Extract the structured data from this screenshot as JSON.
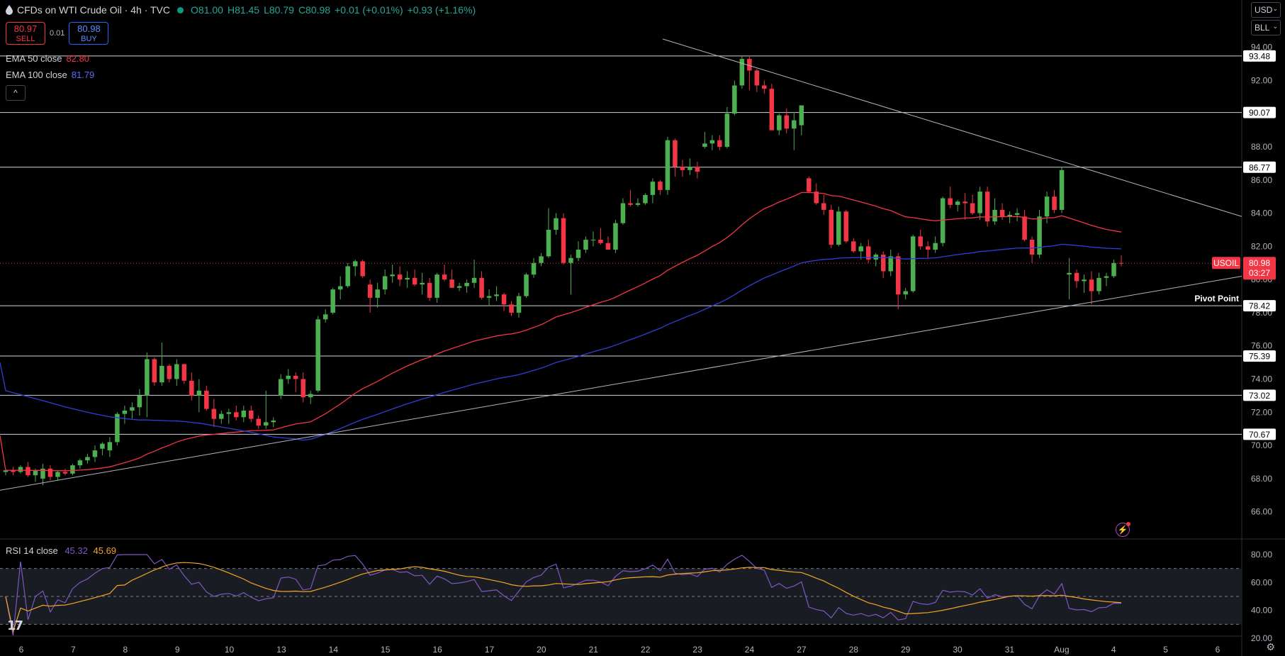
{
  "header": {
    "title": "CFDs on WTI Crude Oil · 4h · TVC",
    "open": "O81.00",
    "high": "H81.45",
    "low": "L80.79",
    "close": "C80.98",
    "change": "+0.01 (+0.01%)",
    "change2": "+0.93 (+1.16%)"
  },
  "trade": {
    "sell_price": "80.97",
    "sell_label": "SELL",
    "spread": "0.01",
    "buy_price": "80.98",
    "buy_label": "BUY"
  },
  "indicators": {
    "ema50_label": "EMA 50 close",
    "ema50_value": "82.80",
    "ema100_label": "EMA 100 close",
    "ema100_value": "81.79",
    "collapse_glyph": "^"
  },
  "currency": {
    "value": "USD",
    "unit": "BLL"
  },
  "rsi": {
    "label": "RSI 14 close",
    "value": "45.32",
    "ma_value": "45.69"
  },
  "logo": "17",
  "colors": {
    "up": "#4caf50",
    "down": "#f23645",
    "ema50": "#f23645",
    "ema100": "#2f3fd6",
    "rsi": "#7e57c2",
    "rsi_ma": "#f5a623"
  },
  "chart_data": {
    "type": "candlestick",
    "symbol_label": "USOIL",
    "last_price": "80.98",
    "countdown": "03:27",
    "y_axis": {
      "min": 65.0,
      "max": 94.5,
      "ticks": [
        "94.00",
        "92.00",
        "90.00",
        "88.00",
        "86.00",
        "84.00",
        "82.00",
        "80.00",
        "78.00",
        "76.00",
        "74.00",
        "72.00",
        "70.00",
        "68.00",
        "66.00"
      ]
    },
    "x_ticks": [
      "6",
      "7",
      "8",
      "9",
      "10",
      "13",
      "14",
      "15",
      "16",
      "17",
      "20",
      "21",
      "22",
      "23",
      "24",
      "27",
      "28",
      "29",
      "30",
      "31",
      "Aug",
      "4",
      "5",
      "6"
    ],
    "levels": [
      93.48,
      90.07,
      86.77,
      78.42,
      75.39,
      73.02,
      70.67
    ],
    "level_labels": [
      "93.48",
      "90.07",
      "86.77",
      "78.42",
      "75.39",
      "73.02",
      "70.67"
    ],
    "pivot_label": "Pivot Point",
    "candles": [
      [
        68.4,
        68.6,
        68.2,
        68.5
      ],
      [
        68.5,
        68.7,
        68.2,
        68.4
      ],
      [
        68.4,
        68.8,
        68.3,
        68.7
      ],
      [
        68.7,
        69.0,
        68.1,
        68.2
      ],
      [
        68.2,
        68.6,
        67.8,
        68.5
      ],
      [
        68.0,
        68.9,
        67.6,
        68.6
      ],
      [
        68.6,
        68.8,
        67.9,
        68.1
      ],
      [
        68.1,
        68.5,
        67.9,
        68.4
      ],
      [
        68.4,
        68.6,
        68.2,
        68.3
      ],
      [
        68.3,
        68.9,
        68.2,
        68.8
      ],
      [
        68.8,
        69.2,
        68.6,
        69.1
      ],
      [
        69.1,
        69.5,
        68.9,
        69.3
      ],
      [
        69.3,
        70.0,
        69.0,
        69.7
      ],
      [
        69.8,
        70.2,
        69.4,
        70.1
      ],
      [
        69.7,
        70.5,
        69.3,
        70.2
      ],
      [
        70.2,
        72.0,
        70.0,
        71.9
      ],
      [
        71.9,
        72.4,
        71.3,
        72.1
      ],
      [
        72.1,
        72.6,
        71.6,
        72.3
      ],
      [
        72.3,
        73.4,
        71.8,
        73.0
      ],
      [
        73.0,
        75.6,
        71.7,
        75.2
      ],
      [
        75.2,
        75.3,
        73.6,
        73.8
      ],
      [
        73.8,
        76.2,
        73.6,
        74.8
      ],
      [
        74.8,
        74.9,
        73.8,
        74.0
      ],
      [
        74.0,
        75.2,
        73.6,
        74.9
      ],
      [
        74.9,
        74.9,
        73.7,
        73.9
      ],
      [
        73.9,
        74.4,
        72.7,
        73.0
      ],
      [
        73.0,
        74.0,
        72.0,
        73.3
      ],
      [
        73.3,
        73.6,
        72.1,
        72.2
      ],
      [
        72.2,
        72.8,
        71.1,
        71.6
      ],
      [
        71.6,
        72.1,
        71.3,
        71.9
      ],
      [
        71.9,
        72.2,
        71.3,
        72.0
      ],
      [
        72.0,
        72.4,
        71.5,
        71.7
      ],
      [
        71.7,
        72.4,
        71.4,
        72.1
      ],
      [
        72.1,
        72.4,
        71.4,
        71.6
      ],
      [
        71.6,
        71.8,
        71.0,
        71.2
      ],
      [
        71.2,
        73.3,
        71.0,
        71.4
      ],
      [
        71.4,
        71.7,
        71.1,
        71.5
      ],
      [
        73.0,
        74.3,
        72.8,
        74.0
      ],
      [
        74.0,
        74.6,
        73.7,
        74.2
      ],
      [
        74.2,
        74.4,
        73.2,
        74.0
      ],
      [
        74.0,
        74.4,
        72.6,
        72.9
      ],
      [
        72.9,
        73.3,
        72.5,
        73.1
      ],
      [
        73.3,
        77.8,
        73.2,
        77.6
      ],
      [
        77.6,
        78.2,
        77.4,
        77.9
      ],
      [
        78.0,
        79.5,
        77.9,
        79.4
      ],
      [
        79.4,
        80.2,
        78.8,
        79.6
      ],
      [
        79.6,
        81.0,
        79.5,
        80.8
      ],
      [
        80.8,
        81.2,
        80.2,
        81.1
      ],
      [
        81.1,
        81.2,
        80.1,
        80.2
      ],
      [
        79.7,
        80.0,
        78.0,
        78.9
      ],
      [
        78.9,
        79.8,
        78.3,
        79.4
      ],
      [
        79.4,
        80.6,
        79.1,
        80.2
      ],
      [
        80.2,
        80.9,
        79.8,
        80.3
      ],
      [
        80.3,
        80.8,
        79.6,
        80.0
      ],
      [
        80.0,
        80.5,
        79.5,
        80.1
      ],
      [
        80.1,
        80.6,
        79.6,
        79.7
      ],
      [
        79.7,
        80.4,
        79.1,
        79.8
      ],
      [
        79.8,
        80.1,
        78.7,
        78.9
      ],
      [
        78.9,
        80.4,
        78.6,
        80.3
      ],
      [
        80.3,
        80.9,
        79.9,
        80.0
      ],
      [
        80.0,
        80.6,
        79.5,
        79.5
      ],
      [
        79.5,
        79.8,
        79.3,
        79.6
      ],
      [
        79.6,
        80.0,
        79.2,
        79.8
      ],
      [
        79.8,
        81.2,
        79.5,
        80.1
      ],
      [
        80.1,
        80.5,
        78.8,
        78.9
      ],
      [
        78.9,
        79.4,
        78.4,
        79.0
      ],
      [
        79.0,
        79.6,
        78.7,
        79.1
      ],
      [
        79.1,
        79.2,
        78.1,
        78.5
      ],
      [
        78.5,
        78.7,
        77.8,
        78.0
      ],
      [
        78.0,
        79.2,
        77.7,
        79.0
      ],
      [
        79.0,
        80.4,
        78.9,
        80.3
      ],
      [
        80.3,
        81.3,
        80.1,
        81.0
      ],
      [
        81.0,
        81.6,
        80.8,
        81.4
      ],
      [
        81.4,
        84.3,
        81.3,
        83.0
      ],
      [
        83.0,
        84.0,
        82.7,
        83.7
      ],
      [
        83.7,
        84.0,
        80.9,
        81.0
      ],
      [
        81.0,
        81.5,
        79.1,
        81.3
      ],
      [
        81.3,
        82.3,
        81.1,
        81.8
      ],
      [
        81.8,
        82.6,
        81.6,
        82.4
      ],
      [
        82.4,
        82.9,
        82.0,
        82.4
      ],
      [
        82.4,
        83.1,
        82.1,
        82.2
      ],
      [
        82.2,
        82.6,
        81.8,
        81.8
      ],
      [
        81.8,
        83.6,
        81.6,
        83.4
      ],
      [
        83.4,
        84.9,
        83.3,
        84.6
      ],
      [
        84.6,
        85.4,
        84.4,
        84.5
      ],
      [
        84.5,
        84.9,
        84.4,
        84.6
      ],
      [
        84.6,
        85.2,
        84.5,
        85.1
      ],
      [
        85.1,
        86.1,
        84.6,
        85.9
      ],
      [
        85.9,
        86.0,
        85.1,
        85.4
      ],
      [
        85.4,
        88.6,
        85.1,
        88.4
      ],
      [
        88.4,
        88.5,
        86.2,
        86.8
      ],
      [
        86.8,
        87.2,
        86.2,
        86.6
      ],
      [
        86.6,
        87.3,
        86.3,
        86.8
      ],
      [
        86.8,
        87.1,
        86.1,
        86.5
      ],
      [
        88.0,
        88.9,
        87.9,
        88.2
      ],
      [
        88.2,
        88.7,
        87.8,
        88.4
      ],
      [
        88.4,
        88.7,
        87.8,
        88.0
      ],
      [
        88.0,
        90.4,
        87.9,
        90.0
      ],
      [
        90.0,
        92.0,
        89.9,
        91.7
      ],
      [
        91.7,
        93.5,
        91.5,
        93.3
      ],
      [
        93.3,
        93.5,
        91.4,
        92.6
      ],
      [
        92.6,
        92.7,
        91.3,
        91.7
      ],
      [
        91.7,
        92.0,
        91.2,
        91.5
      ],
      [
        91.5,
        91.8,
        89.0,
        89.0
      ],
      [
        89.0,
        90.0,
        88.7,
        89.9
      ],
      [
        89.9,
        90.3,
        88.8,
        89.1
      ],
      [
        89.1,
        90.1,
        87.8,
        89.6
      ],
      [
        89.3,
        90.4,
        88.7,
        90.5
      ],
      [
        86.1,
        86.2,
        85.2,
        85.3
      ],
      [
        85.3,
        85.8,
        84.5,
        84.6
      ],
      [
        84.6,
        85.1,
        83.9,
        84.2
      ],
      [
        84.2,
        84.5,
        81.9,
        82.1
      ],
      [
        82.1,
        84.4,
        82.0,
        84.1
      ],
      [
        84.1,
        84.2,
        82.2,
        82.3
      ],
      [
        82.3,
        82.5,
        81.6,
        81.7
      ],
      [
        81.7,
        82.2,
        81.2,
        82.0
      ],
      [
        82.0,
        82.4,
        81.0,
        81.2
      ],
      [
        81.2,
        81.6,
        80.8,
        81.5
      ],
      [
        81.5,
        81.7,
        80.1,
        80.5
      ],
      [
        80.5,
        81.8,
        80.2,
        81.4
      ],
      [
        81.4,
        81.6,
        78.2,
        79.1
      ],
      [
        79.1,
        79.5,
        78.8,
        79.3
      ],
      [
        79.3,
        82.7,
        79.2,
        82.6
      ],
      [
        82.6,
        83.0,
        81.8,
        82.0
      ],
      [
        82.0,
        82.3,
        81.3,
        81.8
      ],
      [
        81.8,
        82.6,
        81.6,
        82.2
      ],
      [
        82.2,
        85.0,
        82.0,
        84.9
      ],
      [
        84.9,
        85.6,
        84.3,
        84.5
      ],
      [
        84.5,
        84.8,
        84.1,
        84.7
      ],
      [
        84.7,
        85.2,
        83.6,
        84.6
      ],
      [
        84.6,
        85.1,
        83.9,
        84.0
      ],
      [
        84.0,
        85.6,
        83.6,
        85.3
      ],
      [
        85.3,
        85.6,
        83.2,
        83.5
      ],
      [
        83.5,
        84.9,
        83.3,
        84.2
      ],
      [
        84.2,
        84.6,
        83.6,
        83.8
      ],
      [
        83.8,
        84.1,
        83.4,
        83.9
      ],
      [
        83.9,
        84.3,
        83.5,
        84.0
      ],
      [
        83.8,
        84.2,
        82.3,
        82.4
      ],
      [
        82.4,
        82.6,
        81.0,
        81.5
      ],
      [
        81.5,
        84.2,
        81.3,
        83.8
      ],
      [
        83.8,
        85.3,
        83.4,
        85.0
      ],
      [
        85.0,
        85.4,
        84.0,
        84.2
      ],
      [
        84.2,
        86.8,
        84.0,
        86.6
      ],
      [
        80.3,
        81.3,
        78.8,
        80.4
      ],
      [
        80.4,
        80.6,
        79.5,
        79.9
      ],
      [
        79.9,
        80.3,
        79.2,
        80.0
      ],
      [
        80.0,
        80.5,
        78.5,
        79.3
      ],
      [
        79.3,
        80.4,
        79.1,
        80.1
      ],
      [
        80.1,
        80.4,
        79.6,
        80.2
      ],
      [
        80.2,
        81.2,
        80.1,
        81.0
      ],
      [
        81.0,
        81.45,
        80.79,
        80.98
      ]
    ],
    "rsi_axis": {
      "min": 20,
      "max": 80,
      "ticks": [
        "80.00",
        "60.00",
        "40.00",
        "20.00"
      ],
      "bands": [
        70,
        50,
        30
      ]
    }
  }
}
